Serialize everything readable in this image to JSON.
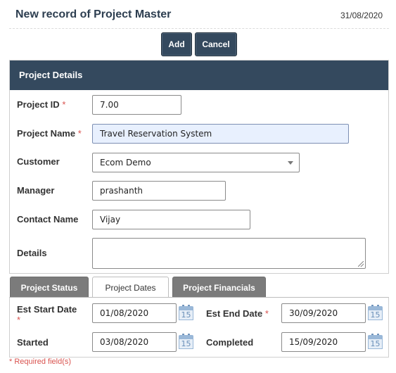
{
  "header": {
    "title": "New record of Project Master",
    "date": "31/08/2020"
  },
  "toolbar": {
    "add_label": "Add",
    "cancel_label": "Cancel"
  },
  "details": {
    "panel_title": "Project Details",
    "fields": {
      "project_id": {
        "label": "Project ID",
        "value": "7.00",
        "required": "*"
      },
      "project_name": {
        "label": "Project Name",
        "value": "Travel Reservation System",
        "required": "*"
      },
      "customer": {
        "label": "Customer",
        "value": "Ecom Demo"
      },
      "manager": {
        "label": "Manager",
        "value": "prashanth"
      },
      "contact_name": {
        "label": "Contact Name",
        "value": "Vijay"
      },
      "details": {
        "label": "Details",
        "value": ""
      }
    }
  },
  "tabs": [
    {
      "label": "Project Status"
    },
    {
      "label": "Project Dates"
    },
    {
      "label": "Project Financials"
    }
  ],
  "dates": {
    "est_start": {
      "label": "Est Start Date",
      "value": "01/08/2020",
      "required": "*"
    },
    "est_end": {
      "label": "Est End Date",
      "value": "30/09/2020",
      "required": "*"
    },
    "started": {
      "label": "Started",
      "value": "03/08/2020"
    },
    "completed": {
      "label": "Completed",
      "value": "15/09/2020"
    },
    "calendar_day": "15"
  },
  "footer": {
    "required_note": "* Required field(s)"
  },
  "colors": {
    "accent": "#34495e",
    "required": "#d9534f",
    "inactive_tab": "#7b7b7b"
  }
}
